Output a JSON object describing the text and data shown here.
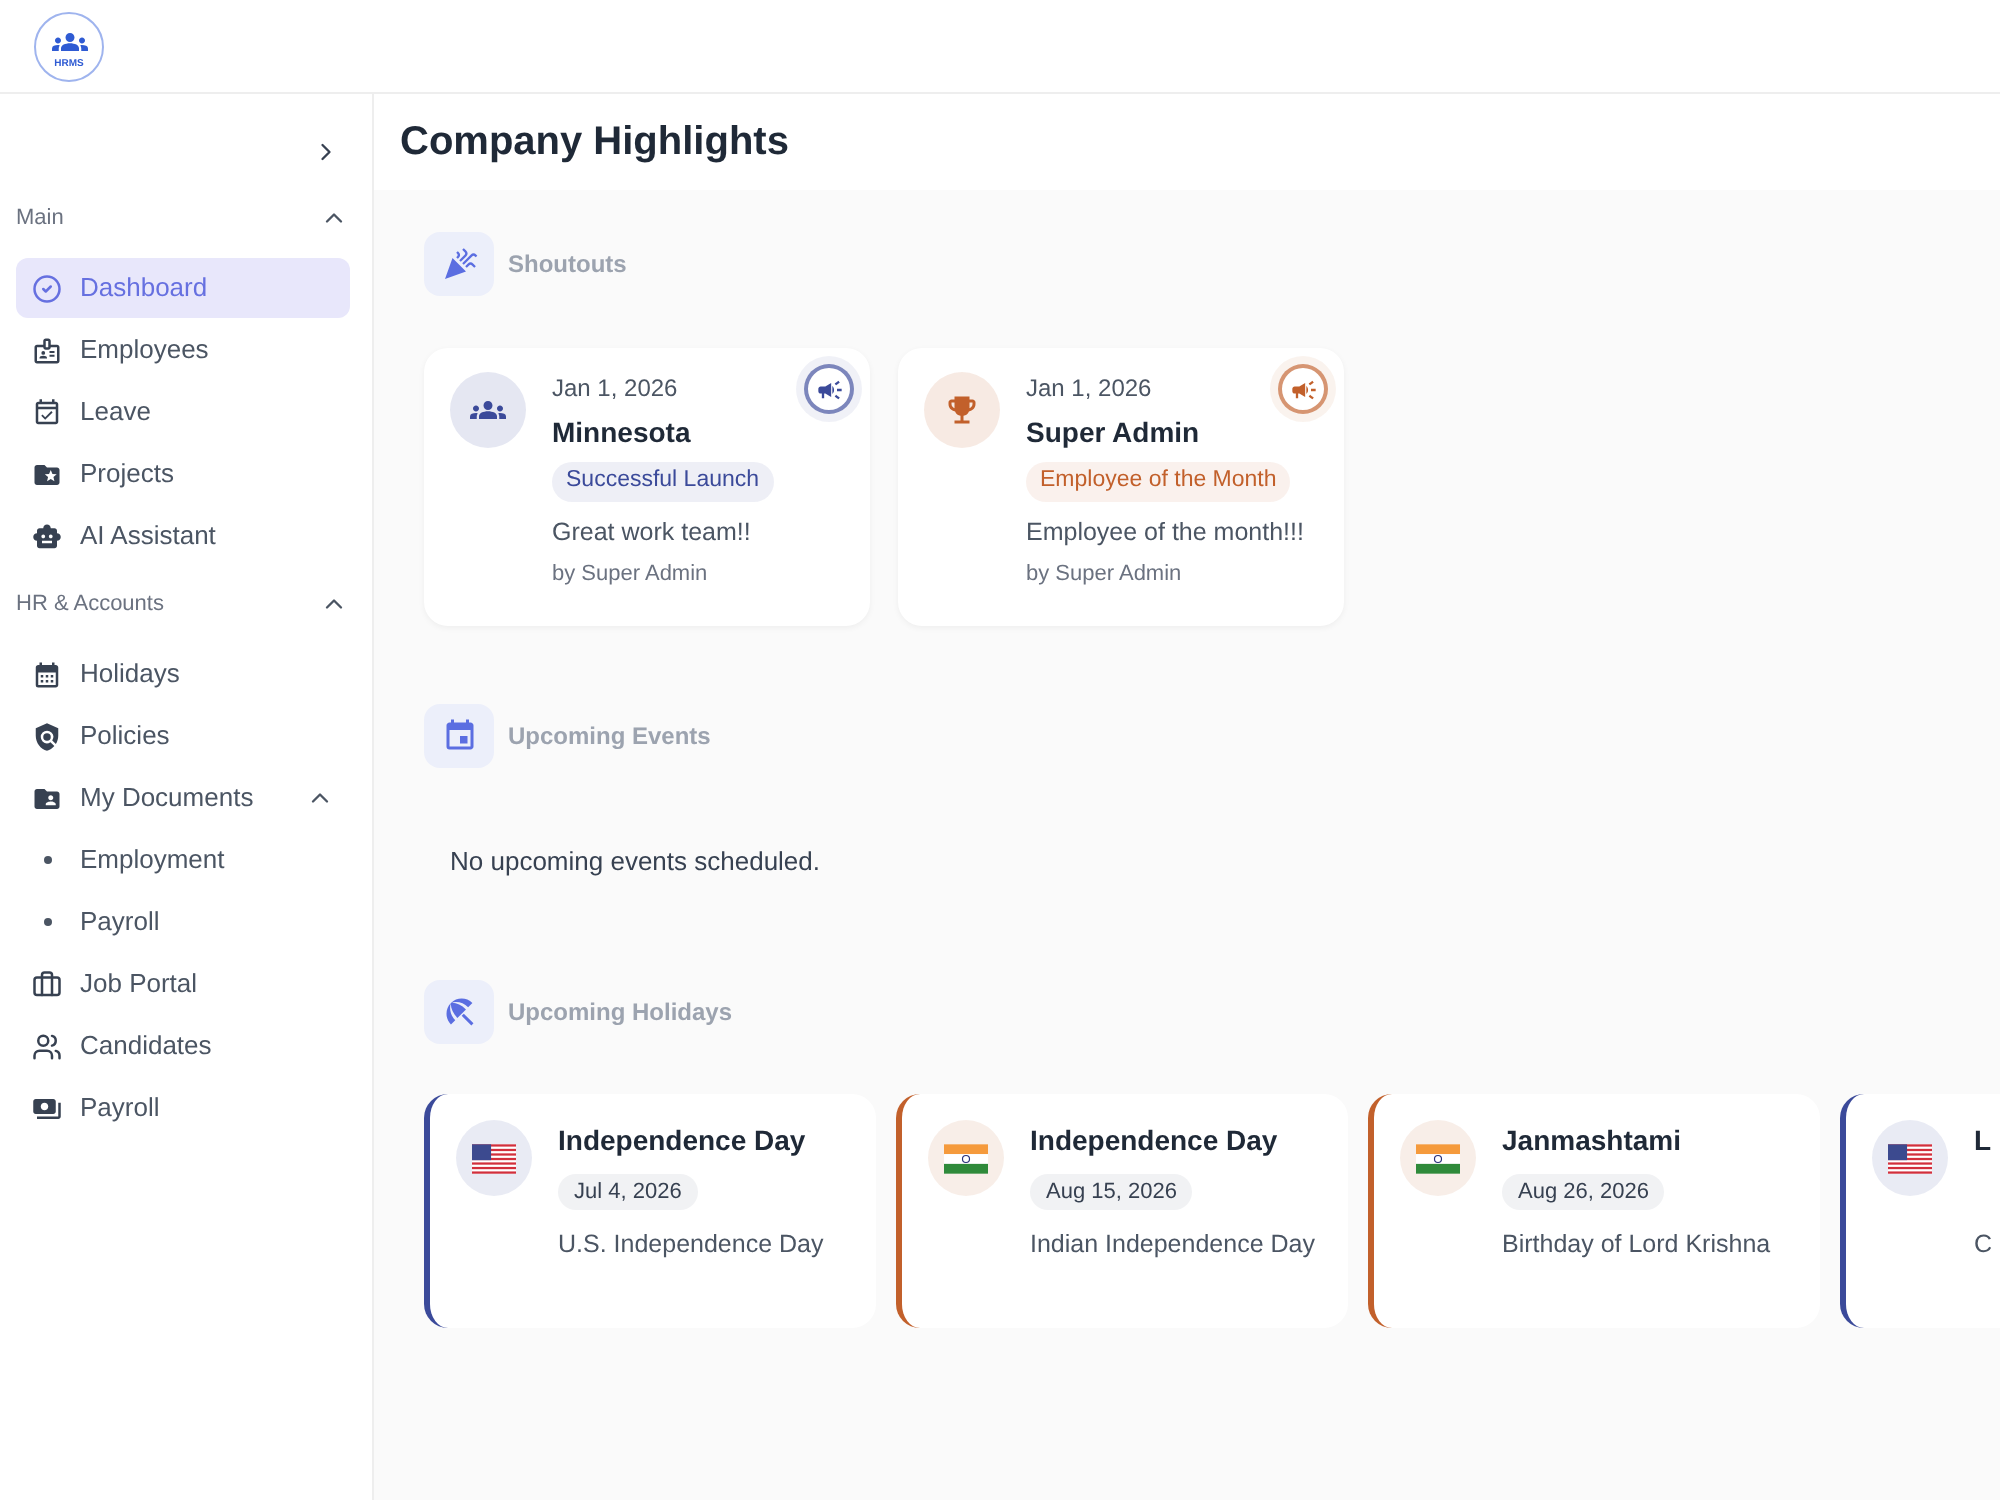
{
  "logo": {
    "text": "HRMS"
  },
  "sidebar": {
    "sections": [
      {
        "title": "Main",
        "expanded": true,
        "items": [
          {
            "label": "Dashboard",
            "selected": true
          },
          {
            "label": "Employees",
            "selected": false
          },
          {
            "label": "Leave",
            "selected": false
          },
          {
            "label": "Projects",
            "selected": false
          },
          {
            "label": "AI Assistant",
            "selected": false
          }
        ]
      },
      {
        "title": "HR & Accounts",
        "expanded": true,
        "items": [
          {
            "label": "Holidays",
            "selected": false
          },
          {
            "label": "Policies",
            "selected": false
          },
          {
            "label": "My Documents",
            "selected": false,
            "expanded": true,
            "children": [
              {
                "label": "Employment",
                "selected": false
              },
              {
                "label": "Payroll",
                "selected": false
              }
            ]
          },
          {
            "label": "Job Portal",
            "selected": false
          },
          {
            "label": "Candidates",
            "selected": false
          },
          {
            "label": "Payroll",
            "selected": false
          }
        ]
      }
    ]
  },
  "page": {
    "title": "Company Highlights"
  },
  "shoutouts": {
    "title": "Shoutouts",
    "cards": [
      {
        "kind": "team",
        "color": "#3b4a9a",
        "date": "Jan 1, 2026",
        "name": "Minnesota",
        "tag": "Successful Launch",
        "message": "Great work team!!",
        "author": "by Super Admin"
      },
      {
        "kind": "award",
        "color": "#c2602b",
        "date": "Jan 1, 2026",
        "name": "Super Admin",
        "tag": "Employee of the Month",
        "message": "Employee of the month!!!",
        "author": "by Super Admin"
      }
    ]
  },
  "events": {
    "title": "Upcoming Events",
    "empty_message": "No upcoming events scheduled."
  },
  "holidays": {
    "title": "Upcoming Holidays",
    "cards": [
      {
        "kind": "us",
        "color": "#3b4a9a",
        "name": "Independence Day",
        "date": "Jul 4, 2026",
        "description": "U.S. Independence Day"
      },
      {
        "kind": "in",
        "color": "#c2602b",
        "name": "Independence Day",
        "date": "Aug 15, 2026",
        "description": "Indian Independence Day"
      },
      {
        "kind": "in",
        "color": "#c2602b",
        "name": "Janmashtami",
        "date": "Aug 26, 2026",
        "description": "Birthday of Lord Krishna"
      },
      {
        "kind": "us",
        "color": "#3b4a9a",
        "name": "L",
        "description": "C"
      }
    ]
  }
}
